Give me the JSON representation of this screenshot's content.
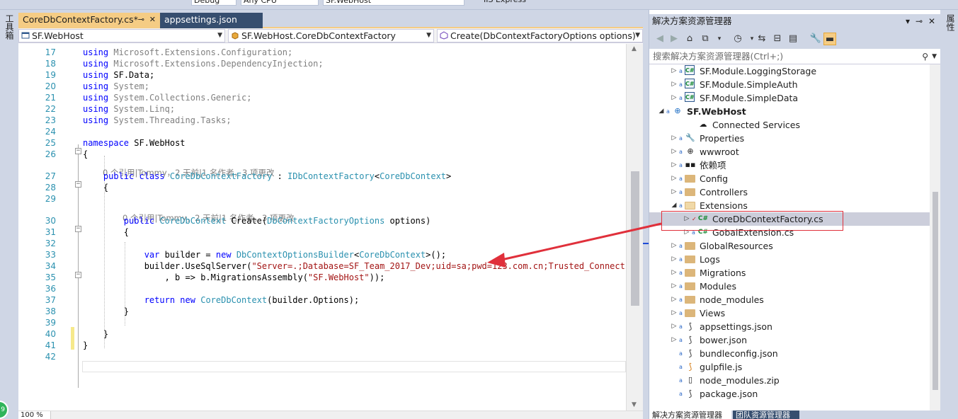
{
  "toolbar": {
    "config_value": "Debug",
    "platform_value": "Any CPU",
    "startup_value": "SF.WebHost",
    "run_label": "IIS Express"
  },
  "left_strip": {
    "label": "工具箱"
  },
  "right_strip": {
    "label": "属性"
  },
  "status_badge": {
    "value": "9"
  },
  "editor": {
    "tabs": [
      {
        "label": "CoreDbContextFactory.cs*",
        "active": true
      },
      {
        "label": "appsettings.json",
        "active": false
      }
    ],
    "nav": {
      "project": "SF.WebHost",
      "class": "SF.WebHost.CoreDbContextFactory",
      "member": "Create(DbContextFactoryOptions options)"
    },
    "zoom": "100 %",
    "lines": [
      {
        "n": "17",
        "text": "using Microsoft.Extensions.Configuration;"
      },
      {
        "n": "18",
        "text": "using Microsoft.Extensions.DependencyInjection;"
      },
      {
        "n": "19",
        "text": "using SF.Data;"
      },
      {
        "n": "20",
        "text": "using System;"
      },
      {
        "n": "21",
        "text": "using System.Collections.Generic;"
      },
      {
        "n": "22",
        "text": "using System.Linq;"
      },
      {
        "n": "23",
        "text": "using System.Threading.Tasks;"
      },
      {
        "n": "24",
        "text": ""
      },
      {
        "n": "25",
        "text": "namespace SF.WebHost"
      },
      {
        "n": "26",
        "text": "{"
      },
      {
        "n": "27",
        "text": "    public class CoreDbContextFactory : IDbContextFactory<CoreDbContext>"
      },
      {
        "n": "28",
        "text": "    {"
      },
      {
        "n": "29",
        "text": ""
      },
      {
        "n": "30",
        "text": "        public CoreDbContext Create(DbContextFactoryOptions options)"
      },
      {
        "n": "31",
        "text": "        {"
      },
      {
        "n": "32",
        "text": ""
      },
      {
        "n": "33",
        "text": "            var builder = new DbContextOptionsBuilder<CoreDbContext>();"
      },
      {
        "n": "34",
        "text": "            builder.UseSqlServer(\"Server=.;Database=SF_Team_2017_Dev;uid=sa;pwd=123.com.cn;Trusted_Connection="
      },
      {
        "n": "35",
        "text": "                , b => b.MigrationsAssembly(\"SF.WebHost\"));"
      },
      {
        "n": "36",
        "text": ""
      },
      {
        "n": "37",
        "text": "            return new CoreDbContext(builder.Options);"
      },
      {
        "n": "38",
        "text": "        }"
      },
      {
        "n": "39",
        "text": ""
      },
      {
        "n": "40",
        "text": "    }"
      },
      {
        "n": "41",
        "text": "}"
      },
      {
        "n": "42",
        "text": ""
      }
    ],
    "lens_class": "0 个引用|Tommy，2 天前|1 名作者，3 项更改",
    "lens_method": "0 个引用|Tommy，2 天前|1 名作者，3 项更改"
  },
  "solution_explorer": {
    "title": "解决方案资源管理器",
    "search_placeholder": "搜索解决方案资源管理器(Ctrl+;)",
    "items": [
      {
        "label": "SF.Module.LoggingStorage",
        "icon": "csproj-icon"
      },
      {
        "label": "SF.Module.SimpleAuth",
        "icon": "csproj-icon"
      },
      {
        "label": "SF.Module.SimpleData",
        "icon": "csproj-icon"
      },
      {
        "label": "SF.WebHost",
        "icon": "web-project-icon"
      },
      {
        "label": "Connected Services",
        "icon": "connected-services-icon"
      },
      {
        "label": "Properties",
        "icon": "wrench-icon"
      },
      {
        "label": "wwwroot",
        "icon": "globe-icon"
      },
      {
        "label": "依赖项",
        "icon": "dependencies-icon"
      },
      {
        "label": "Config",
        "icon": "folder-icon"
      },
      {
        "label": "Controllers",
        "icon": "folder-icon"
      },
      {
        "label": "Extensions",
        "icon": "folder-open-icon"
      },
      {
        "label": "CoreDbContextFactory.cs",
        "icon": "csharp-file-icon"
      },
      {
        "label": "GobalExtension.cs",
        "icon": "csharp-file-icon"
      },
      {
        "label": "GlobalResources",
        "icon": "folder-icon"
      },
      {
        "label": "Logs",
        "icon": "folder-icon"
      },
      {
        "label": "Migrations",
        "icon": "folder-icon"
      },
      {
        "label": "Modules",
        "icon": "folder-icon"
      },
      {
        "label": "node_modules",
        "icon": "folder-icon"
      },
      {
        "label": "Views",
        "icon": "folder-icon"
      },
      {
        "label": "appsettings.json",
        "icon": "json-file-icon"
      },
      {
        "label": "bower.json",
        "icon": "json-file-icon"
      },
      {
        "label": "bundleconfig.json",
        "icon": "json-file-icon"
      },
      {
        "label": "gulpfile.js",
        "icon": "js-file-icon"
      },
      {
        "label": "node_modules.zip",
        "icon": "file-icon"
      },
      {
        "label": "package.json",
        "icon": "json-file-icon"
      }
    ],
    "bottom_tabs": [
      {
        "label": "解决方案资源管理器",
        "active": true
      },
      {
        "label": "团队资源管理器",
        "active": false
      }
    ]
  },
  "colors": {
    "active_tab": "#f5cc84",
    "inactive_tab": "#364e6f",
    "keyword": "#0000ff",
    "type": "#2b91af",
    "string": "#a31515",
    "annotation": "#e0303b"
  }
}
